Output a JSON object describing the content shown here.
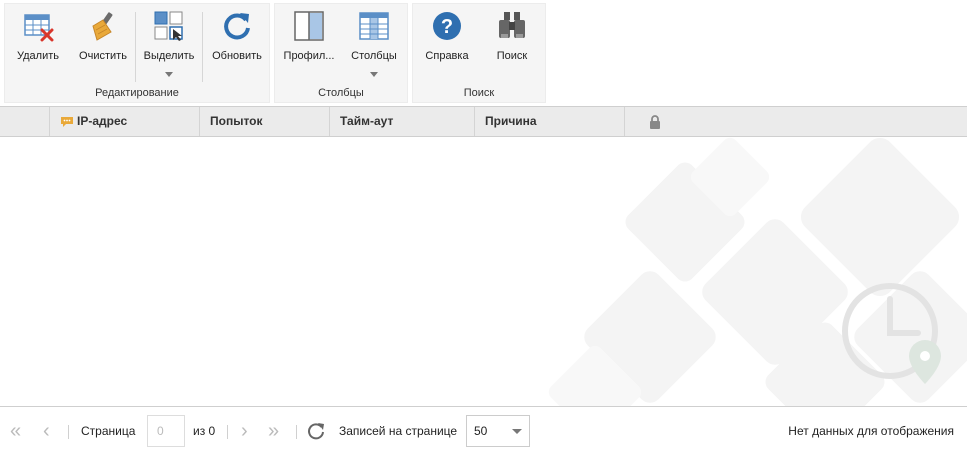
{
  "ribbon": {
    "groups": [
      {
        "label": "Редактирование"
      },
      {
        "label": "Столбцы"
      },
      {
        "label": "Поиск"
      }
    ],
    "buttons": {
      "delete": "Удалить",
      "clear": "Очистить",
      "select": "Выделить",
      "refresh": "Обновить",
      "profile": "Профил...",
      "columns": "Столбцы",
      "help": "Справка",
      "search": "Поиск"
    }
  },
  "grid": {
    "columns": [
      "IP-адрес",
      "Попыток",
      "Тайм-аут",
      "Причина"
    ],
    "lock_icon": "lock-icon"
  },
  "pager": {
    "page_label": "Страница",
    "page_value": "0",
    "of_label": "из 0",
    "per_page_label": "Записей на странице",
    "per_page_value": "50",
    "empty_text": "Нет данных для отображения"
  },
  "colors": {
    "accent_blue": "#2f6fb0",
    "delete_red": "#d9362b",
    "header_bg": "#ebebeb"
  }
}
